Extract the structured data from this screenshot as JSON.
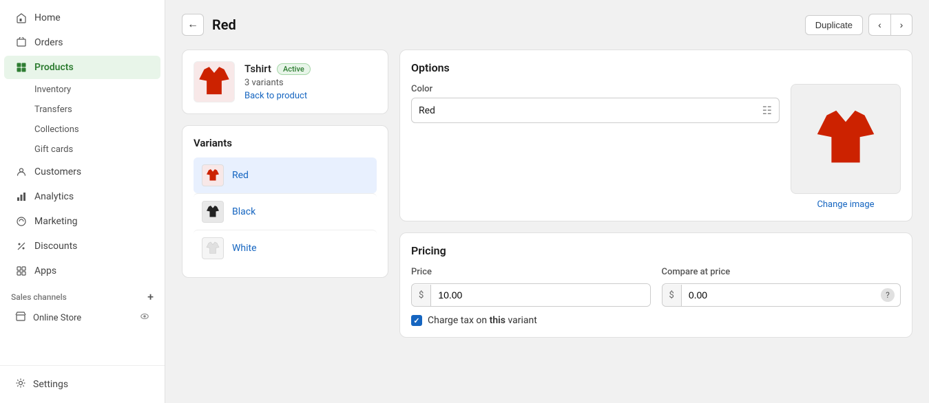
{
  "sidebar": {
    "nav_items": [
      {
        "id": "home",
        "label": "Home",
        "icon": "home"
      },
      {
        "id": "orders",
        "label": "Orders",
        "icon": "orders"
      },
      {
        "id": "products",
        "label": "Products",
        "icon": "products",
        "active": true
      },
      {
        "id": "inventory",
        "label": "Inventory",
        "icon": "",
        "sub": true
      },
      {
        "id": "transfers",
        "label": "Transfers",
        "icon": "",
        "sub": true
      },
      {
        "id": "collections",
        "label": "Collections",
        "icon": "",
        "sub": true
      },
      {
        "id": "gift-cards",
        "label": "Gift cards",
        "icon": "",
        "sub": true
      },
      {
        "id": "customers",
        "label": "Customers",
        "icon": "customers"
      },
      {
        "id": "analytics",
        "label": "Analytics",
        "icon": "analytics"
      },
      {
        "id": "marketing",
        "label": "Marketing",
        "icon": "marketing"
      },
      {
        "id": "discounts",
        "label": "Discounts",
        "icon": "discounts"
      },
      {
        "id": "apps",
        "label": "Apps",
        "icon": "apps"
      }
    ],
    "sales_channels_label": "Sales channels",
    "online_store_label": "Online Store",
    "settings_label": "Settings"
  },
  "header": {
    "title": "Red",
    "duplicate_label": "Duplicate"
  },
  "product_card": {
    "name": "Tshirt",
    "status": "Active",
    "variants_text": "3 variants",
    "back_link_label": "Back to product"
  },
  "variants": {
    "title": "Variants",
    "items": [
      {
        "id": "red",
        "label": "Red",
        "color": "#cc2200",
        "selected": true
      },
      {
        "id": "black",
        "label": "Black",
        "color": "#222222",
        "selected": false
      },
      {
        "id": "white",
        "label": "White",
        "color": "#f0f0f0",
        "selected": false
      }
    ]
  },
  "options": {
    "title": "Options",
    "color_label": "Color",
    "color_value": "Red",
    "change_image_label": "Change image"
  },
  "pricing": {
    "title": "Pricing",
    "price_label": "Price",
    "price_currency": "$",
    "price_value": "10.00",
    "compare_label": "Compare at price",
    "compare_currency": "$",
    "compare_value": "0.00",
    "charge_tax_label": "Charge tax on this variant"
  }
}
